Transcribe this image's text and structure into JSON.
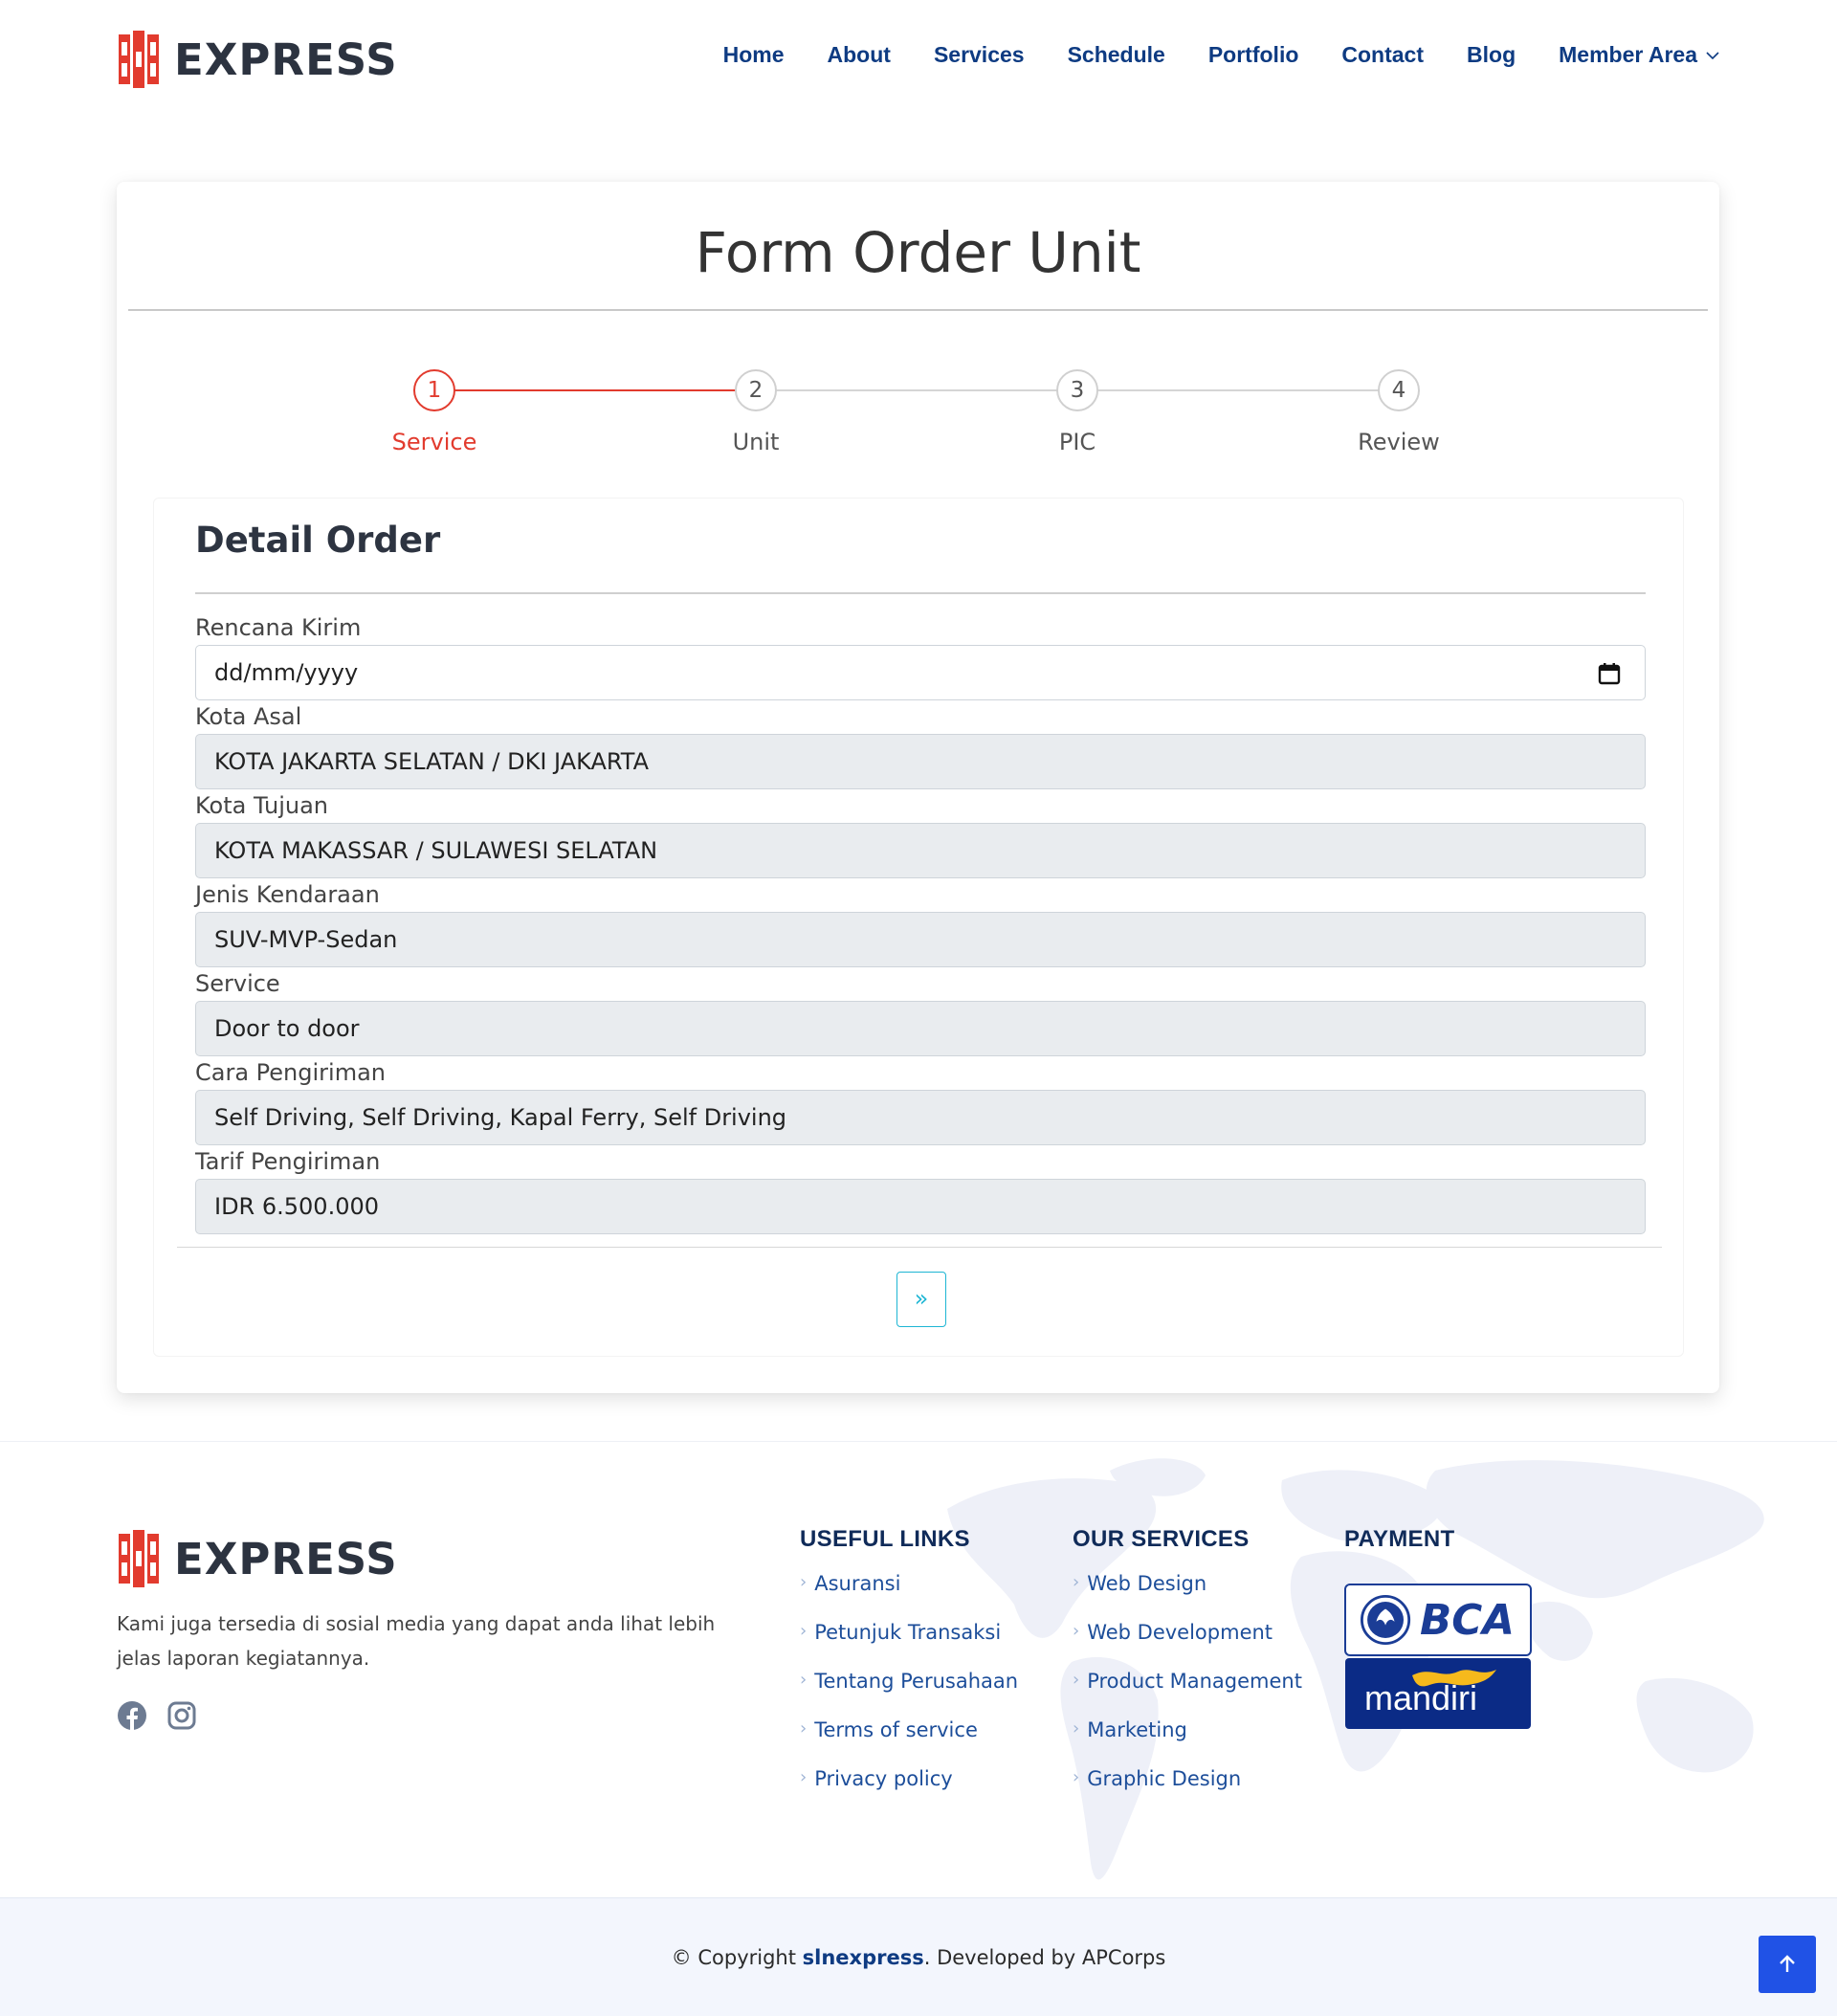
{
  "header": {
    "logo_text": "EXPRESS",
    "nav": [
      {
        "label": "Home"
      },
      {
        "label": "About"
      },
      {
        "label": "Services"
      },
      {
        "label": "Schedule"
      },
      {
        "label": "Portfolio"
      },
      {
        "label": "Contact"
      },
      {
        "label": "Blog"
      },
      {
        "label": "Member Area"
      }
    ]
  },
  "form": {
    "title": "Form Order Unit",
    "steps": [
      {
        "number": "1",
        "label": "Service"
      },
      {
        "number": "2",
        "label": "Unit"
      },
      {
        "number": "3",
        "label": "PIC"
      },
      {
        "number": "4",
        "label": "Review"
      }
    ],
    "panel_title": "Detail Order",
    "fields": {
      "rencana_kirim": {
        "label": "Rencana Kirim",
        "placeholder": "dd/mm/yyyy"
      },
      "kota_asal": {
        "label": "Kota Asal",
        "value": "KOTA JAKARTA SELATAN / DKI JAKARTA"
      },
      "kota_tujuan": {
        "label": "Kota Tujuan",
        "value": "KOTA MAKASSAR / SULAWESI SELATAN"
      },
      "jenis_kendaraan": {
        "label": "Jenis Kendaraan",
        "value": "SUV-MVP-Sedan"
      },
      "service": {
        "label": "Service",
        "value": "Door to door"
      },
      "cara_pengiriman": {
        "label": "Cara Pengiriman",
        "value": "Self Driving, Self Driving, Kapal Ferry, Self Driving"
      },
      "tarif_pengiriman": {
        "label": "Tarif Pengiriman",
        "value": "IDR 6.500.000"
      }
    },
    "next_label": "»"
  },
  "footer": {
    "logo_text": "EXPRESS",
    "description": "Kami juga tersedia di sosial media yang dapat anda lihat lebih jelas laporan kegiatannya.",
    "useful_links": {
      "title": "USEFUL LINKS",
      "items": [
        "Asuransi",
        "Petunjuk Transaksi",
        "Tentang Perusahaan",
        "Terms of service",
        "Privacy policy"
      ]
    },
    "our_services": {
      "title": "OUR SERVICES",
      "items": [
        "Web Design",
        "Web Development",
        "Product Management",
        "Marketing",
        "Graphic Design"
      ]
    },
    "payment": {
      "title": "PAYMENT",
      "bca": "BCA",
      "mandiri": "mandiri"
    },
    "copyright_prefix": "© Copyright ",
    "copyright_brand": "slnexpress",
    "copyright_suffix": ". Developed by APCorps"
  },
  "colors": {
    "accent_red": "#e23b2e",
    "nav_blue": "#0e3b82",
    "button_cyan": "#1eb6d4",
    "to_top_blue": "#2052e6"
  },
  "icons": {
    "calendar": "calendar-icon",
    "facebook": "facebook-icon",
    "instagram": "instagram-icon",
    "arrow_up": "arrow-up-icon",
    "chevron_down": "chevron-down-icon"
  }
}
